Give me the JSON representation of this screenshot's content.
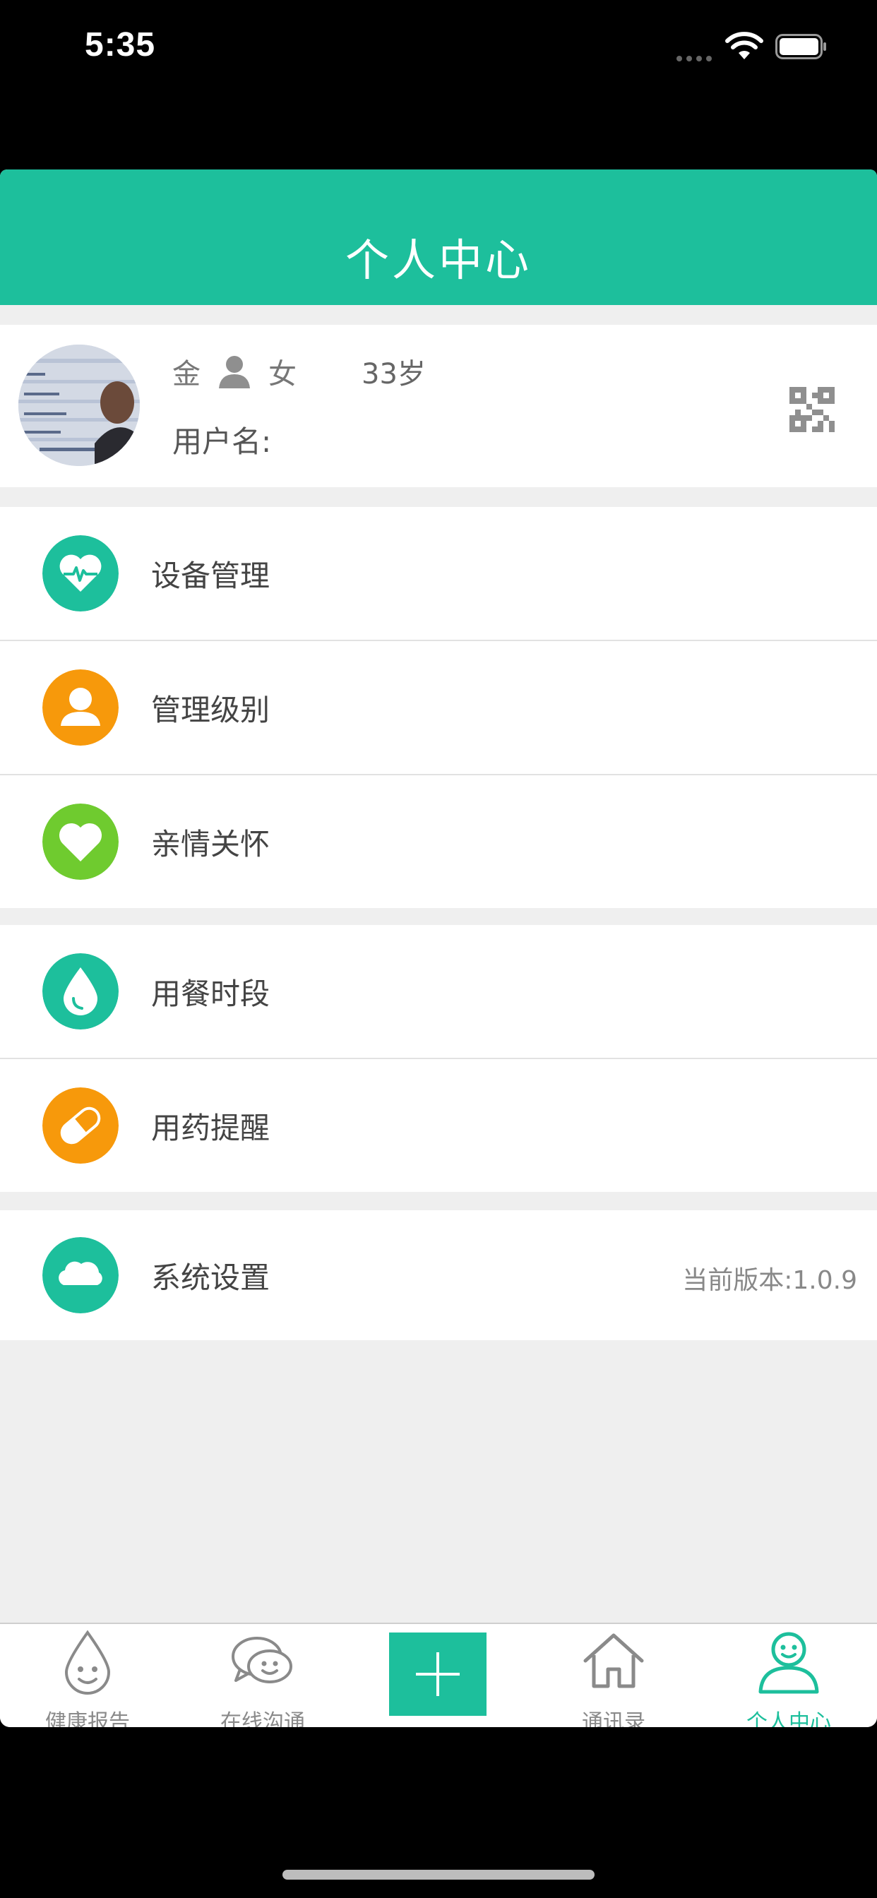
{
  "status_bar": {
    "time": "5:35"
  },
  "header": {
    "title": "个人中心"
  },
  "profile": {
    "surname": "金",
    "gender": "女",
    "age": "33岁",
    "username_label": "用户名:"
  },
  "menu_groups": [
    [
      {
        "label": "设备管理",
        "icon": "heartbeat-icon",
        "color": "#1dbf9c"
      },
      {
        "label": "管理级别",
        "icon": "person-icon",
        "color": "#f7990b"
      },
      {
        "label": "亲情关怀",
        "icon": "heart-icon",
        "color": "#6fcb2f"
      }
    ],
    [
      {
        "label": "用餐时段",
        "icon": "water-drop-icon",
        "color": "#1dbf9c"
      },
      {
        "label": "用药提醒",
        "icon": "pill-icon",
        "color": "#f7990b"
      }
    ],
    [
      {
        "label": "系统设置",
        "icon": "cloud-icon",
        "color": "#1dbf9c",
        "value": "当前版本:1.0.9"
      }
    ]
  ],
  "tabbar": {
    "tabs": [
      {
        "label": "健康报告",
        "icon": "drop-face-icon"
      },
      {
        "label": "在线沟通",
        "icon": "chat-bubble-icon"
      },
      {
        "label": "",
        "icon": "plus-icon"
      },
      {
        "label": "通讯录",
        "icon": "house-icon"
      },
      {
        "label": "个人中心",
        "icon": "user-face-icon",
        "active": true
      }
    ]
  },
  "colors": {
    "accent": "#1dbf9c",
    "orange": "#f7990b",
    "green": "#6fcb2f",
    "background": "#efefef"
  }
}
